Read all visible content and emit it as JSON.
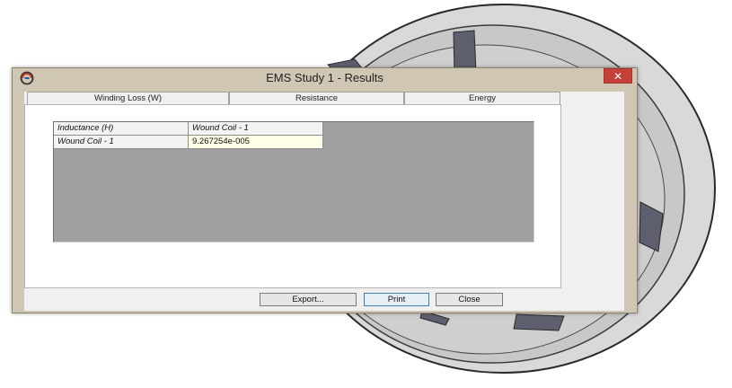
{
  "window": {
    "title": "EMS Study 1 - Results",
    "close_label": "✕"
  },
  "tabs": [
    {
      "label": "Winding Loss (W)"
    },
    {
      "label": "Resistance"
    },
    {
      "label": "Energy"
    }
  ],
  "table": {
    "corner_header": "Inductance (H)",
    "column_headers": [
      "Wound Coil - 1"
    ],
    "rows": [
      {
        "header": "Wound Coil - 1",
        "cells": [
          "9.267254e-005"
        ]
      }
    ]
  },
  "buttons": {
    "export": "Export...",
    "print": "Print",
    "close": "Close"
  },
  "colors": {
    "close_button": "#c7413b",
    "dialog_frame": "#cfc6b4",
    "grid_background": "#a0a0a0",
    "value_cell": "#fffee6"
  },
  "icons": {
    "app": "app-logo-icon",
    "close": "close-icon"
  }
}
